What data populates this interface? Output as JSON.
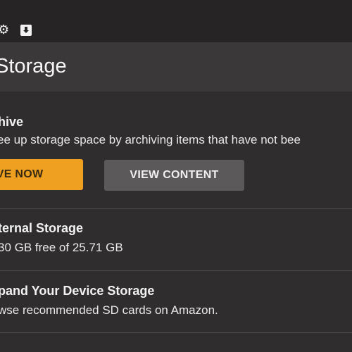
{
  "status_bar": {
    "icons": [
      "gear-icon",
      "download-icon"
    ]
  },
  "header": {
    "title": "Storage"
  },
  "archive": {
    "title": "hive",
    "description": "ee up storage space by archiving items that have not bee",
    "primary_button": "IVE NOW",
    "secondary_button": "VIEW CONTENT"
  },
  "internal_storage": {
    "title": "ternal Storage",
    "value": "30 GB free of 25.71 GB"
  },
  "expand_storage": {
    "title": "pand Your Device Storage",
    "description": "wse recommended SD cards on Amazon."
  },
  "colors": {
    "accent": "#f0a020",
    "background": "#2f2d2d",
    "secondary_button": "#5b5959"
  }
}
